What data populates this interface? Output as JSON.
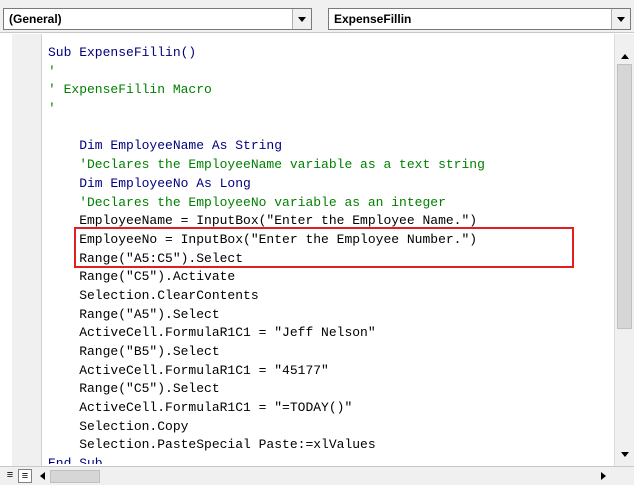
{
  "object_dropdown": {
    "value": "(General)"
  },
  "procedure_dropdown": {
    "value": "ExpenseFillin"
  },
  "code_lines": [
    {
      "kind": "kw",
      "text": "Sub ExpenseFillin()"
    },
    {
      "kind": "cm",
      "text": "'"
    },
    {
      "kind": "cm",
      "text": "' ExpenseFillin Macro"
    },
    {
      "kind": "cm",
      "text": "'"
    },
    {
      "kind": "plain",
      "text": ""
    },
    {
      "kind": "kw",
      "text": "    Dim EmployeeName As String"
    },
    {
      "kind": "cm",
      "text": "    'Declares the EmployeeName variable as a text string"
    },
    {
      "kind": "kw",
      "text": "    Dim EmployeeNo As Long"
    },
    {
      "kind": "cm",
      "text": "    'Declares the EmployeeNo variable as an integer"
    },
    {
      "kind": "plain",
      "text": "    EmployeeName = InputBox(\"Enter the Employee Name.\")"
    },
    {
      "kind": "plain",
      "text": "    EmployeeNo = InputBox(\"Enter the Employee Number.\")"
    },
    {
      "kind": "plain",
      "text": "    Range(\"A5:C5\").Select"
    },
    {
      "kind": "plain",
      "text": "    Range(\"C5\").Activate"
    },
    {
      "kind": "plain",
      "text": "    Selection.ClearContents"
    },
    {
      "kind": "plain",
      "text": "    Range(\"A5\").Select"
    },
    {
      "kind": "plain",
      "text": "    ActiveCell.FormulaR1C1 = \"Jeff Nelson\""
    },
    {
      "kind": "plain",
      "text": "    Range(\"B5\").Select"
    },
    {
      "kind": "plain",
      "text": "    ActiveCell.FormulaR1C1 = \"45177\""
    },
    {
      "kind": "plain",
      "text": "    Range(\"C5\").Select"
    },
    {
      "kind": "plain",
      "text": "    ActiveCell.FormulaR1C1 = \"=TODAY()\""
    },
    {
      "kind": "plain",
      "text": "    Selection.Copy"
    },
    {
      "kind": "plain",
      "text": "    Selection.PasteSpecial Paste:=xlValues"
    },
    {
      "kind": "kw",
      "text": "End Sub"
    }
  ]
}
